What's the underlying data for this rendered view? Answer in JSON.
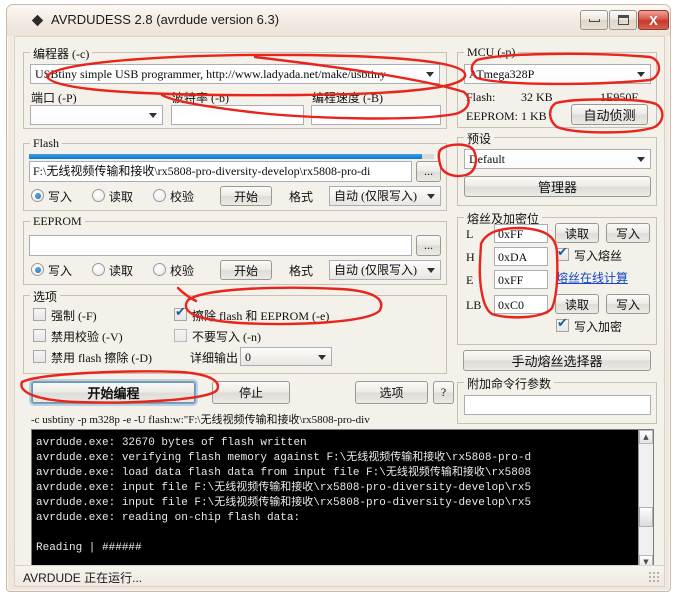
{
  "window": {
    "title": "AVRDUDESS 2.8 (avrdude version 6.3)",
    "icon": "avrdudess-diamond-icon",
    "minimize_label": "",
    "maximize_label": "",
    "close_label": "X"
  },
  "programmer": {
    "legend": "编程器 (-c)",
    "selected": "USBtiny simple USB programmer, http://www.ladyada.net/make/usbtiny",
    "port": {
      "label": "端口 (-P)",
      "value": ""
    },
    "baud": {
      "label": "波特率 (-b)",
      "value": ""
    },
    "bitclock": {
      "label": "编程速度 (-B)",
      "value": ""
    }
  },
  "mcu": {
    "legend": "MCU (-p)",
    "selected": "ATmega328P",
    "flash_label": "Flash:",
    "flash_size": "32 KB",
    "signature": "1E950F",
    "eeprom_label": "EEPROM:",
    "eeprom_size": "1 KB",
    "detect_button": "自动侦测"
  },
  "flash": {
    "legend": "Flash",
    "path": "F:\\无线视频传输和接收\\rx5808-pro-diversity-develop\\rx5808-pro-di",
    "browse_button": "...",
    "progress_percent": 97,
    "write_label": "写入",
    "read_label": "读取",
    "verify_label": "校验",
    "go_button": "开始",
    "format_label": "格式",
    "format_value": "自动 (仅限写入)",
    "selected_mode": "写入"
  },
  "eeprom": {
    "legend": "EEPROM",
    "path": "",
    "browse_button": "...",
    "write_label": "写入",
    "read_label": "读取",
    "verify_label": "校验",
    "go_button": "开始",
    "format_label": "格式",
    "format_value": "自动 (仅限写入)",
    "selected_mode": "写入"
  },
  "options": {
    "legend": "选项",
    "force": {
      "label": "强制 (-F)",
      "checked": false
    },
    "erase": {
      "label": "擦除 flash 和 EEPROM (-e)",
      "checked": true
    },
    "disable_verify": {
      "label": "禁用校验 (-V)",
      "checked": false
    },
    "do_not_write": {
      "label": "不要写入 (-n)",
      "checked": false
    },
    "disable_flash_erase": {
      "label": "禁用 flash 擦除 (-D)",
      "checked": false
    },
    "verbosity_label": "详细输出",
    "verbosity_value": "0"
  },
  "presets": {
    "legend": "预设",
    "selected": "Default",
    "manager_button": "管理器"
  },
  "fuses": {
    "legend": "熔丝及加密位",
    "rows": [
      {
        "name": "L",
        "value": "0xFF"
      },
      {
        "name": "H",
        "value": "0xDA"
      },
      {
        "name": "E",
        "value": "0xFF"
      },
      {
        "name": "LB",
        "value": "0xC0"
      }
    ],
    "fuse_read_button": "读取",
    "fuse_write_button": "写入",
    "lock_read_button": "读取",
    "lock_write_button": "写入",
    "write_fuses_checkbox": {
      "label": "写入熔丝",
      "checked": true
    },
    "write_lock_checkbox": {
      "label": "写入加密",
      "checked": true
    },
    "calculator_link": "熔丝在线计算",
    "manual_selector_button": "手动熔丝选择器"
  },
  "extra_args": {
    "legend": "附加命令行参数",
    "value": ""
  },
  "actions": {
    "program_button": "开始编程",
    "stop_button": "停止",
    "settings_button": "选项",
    "help_button": "?",
    "command_line": "-c usbtiny -p m328p -e -U flash:w:\"F:\\无线视频传输和接收\\rx5808-pro-div"
  },
  "console": {
    "lines": [
      "avrdude.exe: 32670 bytes of flash written",
      "avrdude.exe: verifying flash memory against F:\\无线视频传输和接收\\rx5808-pro-d",
      "avrdude.exe: load data flash data from input file F:\\无线视频传输和接收\\rx5808",
      "avrdude.exe: input file F:\\无线视频传输和接收\\rx5808-pro-diversity-develop\\rx5",
      "avrdude.exe: input file F:\\无线视频传输和接收\\rx5808-pro-diversity-develop\\rx5",
      "avrdude.exe: reading on-chip flash data:",
      "",
      "Reading | ######"
    ],
    "scroll_up_icon": "triangle-up-icon",
    "scroll_down_icon": "triangle-down-icon"
  },
  "statusbar": {
    "text": "AVRDUDE 正在运行..."
  },
  "colors": {
    "accent_blue": "#1276c9",
    "annotation_red": "#e8251c",
    "link_blue": "#1447c4",
    "console_bg": "#000000"
  }
}
